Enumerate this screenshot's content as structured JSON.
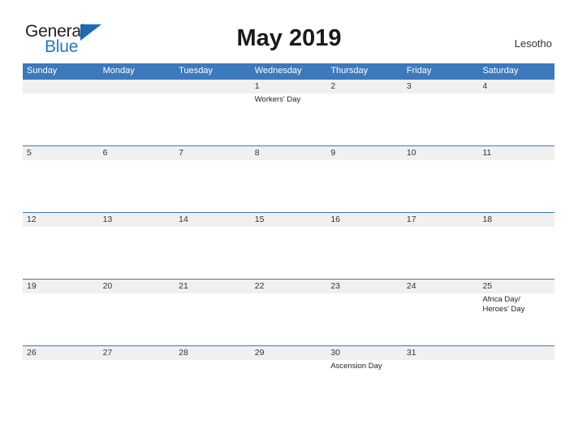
{
  "brand": {
    "word_one": "General",
    "word_two": "Blue",
    "triangle_icon": "triangle-icon",
    "accent_color": "#1b6cb3",
    "blue_text_color": "#1f7ac4"
  },
  "header": {
    "title": "May 2019",
    "country": "Lesotho"
  },
  "calendar": {
    "header_bg": "#3c79bd",
    "date_row_bg": "#f0f0f0",
    "weekdays": [
      "Sunday",
      "Monday",
      "Tuesday",
      "Wednesday",
      "Thursday",
      "Friday",
      "Saturday"
    ],
    "weeks": [
      {
        "days": [
          {
            "date": "",
            "event": ""
          },
          {
            "date": "",
            "event": ""
          },
          {
            "date": "",
            "event": ""
          },
          {
            "date": "1",
            "event": "Workers' Day"
          },
          {
            "date": "2",
            "event": ""
          },
          {
            "date": "3",
            "event": ""
          },
          {
            "date": "4",
            "event": ""
          }
        ]
      },
      {
        "days": [
          {
            "date": "5",
            "event": ""
          },
          {
            "date": "6",
            "event": ""
          },
          {
            "date": "7",
            "event": ""
          },
          {
            "date": "8",
            "event": ""
          },
          {
            "date": "9",
            "event": ""
          },
          {
            "date": "10",
            "event": ""
          },
          {
            "date": "11",
            "event": ""
          }
        ]
      },
      {
        "days": [
          {
            "date": "12",
            "event": ""
          },
          {
            "date": "13",
            "event": ""
          },
          {
            "date": "14",
            "event": ""
          },
          {
            "date": "15",
            "event": ""
          },
          {
            "date": "16",
            "event": ""
          },
          {
            "date": "17",
            "event": ""
          },
          {
            "date": "18",
            "event": ""
          }
        ]
      },
      {
        "days": [
          {
            "date": "19",
            "event": ""
          },
          {
            "date": "20",
            "event": ""
          },
          {
            "date": "21",
            "event": ""
          },
          {
            "date": "22",
            "event": ""
          },
          {
            "date": "23",
            "event": ""
          },
          {
            "date": "24",
            "event": ""
          },
          {
            "date": "25",
            "event": "Africa Day/ Heroes' Day"
          }
        ]
      },
      {
        "days": [
          {
            "date": "26",
            "event": ""
          },
          {
            "date": "27",
            "event": ""
          },
          {
            "date": "28",
            "event": ""
          },
          {
            "date": "29",
            "event": ""
          },
          {
            "date": "30",
            "event": "Ascension Day"
          },
          {
            "date": "31",
            "event": ""
          },
          {
            "date": "",
            "event": ""
          }
        ]
      }
    ]
  }
}
